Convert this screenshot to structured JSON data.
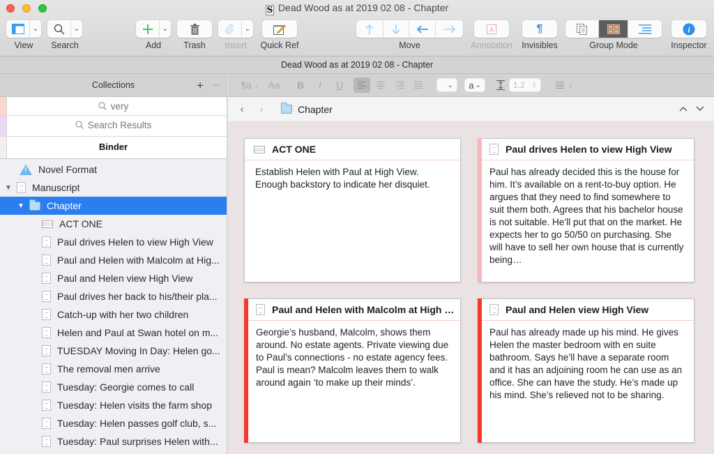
{
  "window": {
    "title": "Dead Wood as at 2019 02 08 - Chapter",
    "doc_icon_glyph": "S"
  },
  "toolbar": {
    "view": "View",
    "search": "Search",
    "add": "Add",
    "trash": "Trash",
    "insert": "Insert",
    "quick_ref": "Quick Ref",
    "move": "Move",
    "annotation": "Annotation",
    "invisibles": "Invisibles",
    "group_mode": "Group Mode",
    "inspector": "Inspector",
    "icons": {
      "view": "layout-icon",
      "search": "magnifier-icon",
      "add": "plus-icon",
      "trash": "trash-icon",
      "insert": "paperclip-icon",
      "quick_ref": "quick-ref-icon",
      "move": [
        "arrow-up-icon",
        "arrow-down-icon",
        "arrow-left-icon",
        "arrow-right-icon"
      ],
      "annotation": "annotation-icon",
      "invisibles": "pilcrow-icon",
      "group_mode": [
        "scrivenings-icon",
        "corkboard-icon",
        "outline-icon"
      ],
      "inspector": "info-icon"
    },
    "group_mode_active": "corkboard",
    "colors": {
      "add": "#3cc36a",
      "move": "#4aa7ee",
      "move_dim": "#a8d3f5",
      "annotation": "#f1a5a5",
      "invisibles": "#2b8ee8",
      "corkboard_active": "#f3b68a",
      "inspector": "#2b8ee8"
    }
  },
  "docbar": {
    "title": "Dead Wood as at 2019 02 08 - Chapter"
  },
  "sidebar": {
    "collections_label": "Collections",
    "add_collection": "+",
    "remove_collection": "−",
    "collection_tabs": [
      {
        "label": "very",
        "icon": "search-icon",
        "color": "#fcd6cb"
      },
      {
        "label": "Search Results",
        "icon": "search-icon",
        "color": "#ead8fb"
      },
      {
        "label": "Binder",
        "icon": "",
        "color": "#efeff4"
      }
    ],
    "binder": [
      {
        "label": "Novel Format",
        "icon": "info-warning-icon",
        "level": 0,
        "disclosure": ""
      },
      {
        "label": "Manuscript",
        "icon": "document-icon",
        "level": 0,
        "disclosure": "▼"
      },
      {
        "label": "Chapter",
        "icon": "folder-icon",
        "level": 1,
        "disclosure": "▼",
        "selected": true
      },
      {
        "label": "ACT ONE",
        "icon": "act-index-icon",
        "level": 2
      },
      {
        "label": "Paul drives Helen to view High View",
        "icon": "document-icon",
        "level": 2
      },
      {
        "label": "Paul and Helen with Malcolm at Hig...",
        "icon": "document-icon",
        "level": 2
      },
      {
        "label": "Paul and Helen view High View",
        "icon": "document-icon",
        "level": 2
      },
      {
        "label": "Paul drives her back to his/their pla...",
        "icon": "document-icon",
        "level": 2
      },
      {
        "label": "Catch-up with her two children",
        "icon": "document-icon",
        "level": 2
      },
      {
        "label": "Helen and Paul at Swan hotel on m...",
        "icon": "document-icon",
        "level": 2
      },
      {
        "label": "TUESDAY Moving In Day: Helen go...",
        "icon": "document-icon",
        "level": 2
      },
      {
        "label": "The removal men arrive",
        "icon": "document-icon",
        "level": 2
      },
      {
        "label": "Tuesday: Georgie comes to call",
        "icon": "document-icon",
        "level": 2
      },
      {
        "label": "Tuesday: Helen visits the farm shop",
        "icon": "document-icon",
        "level": 2
      },
      {
        "label": "Tuesday: Helen passes golf club, s...",
        "icon": "document-icon",
        "level": 2
      },
      {
        "label": "Tuesday: Paul surprises Helen with...",
        "icon": "document-icon",
        "level": 2
      }
    ],
    "selection_color": "#2a7ef0"
  },
  "formatbar": {
    "paragraph_style": "¶a",
    "font": "Aa",
    "bold": "B",
    "italic": "I",
    "underline": "U",
    "alignment_active": "left",
    "text_color_label": "a",
    "line_spacing": "1.2"
  },
  "breadcrumb": {
    "back": "‹",
    "forward": "›",
    "title": "Chapter",
    "up": "⌃",
    "down": "⌄"
  },
  "cards": [
    {
      "title": "ACT ONE",
      "icon": "act-index-icon",
      "label_color": "",
      "synopsis": "Establish Helen with Paul at High View. Enough backstory to indicate her disquiet."
    },
    {
      "title": "Paul drives Helen to view High View",
      "icon": "document-icon",
      "label_color": "#f5b8bc",
      "synopsis": "Paul has already decided this is the house for him. It’s available on a rent-to-buy option. He argues that they need to find somewhere to suit them both. Agrees that his bachelor house is not suitable. He’ll put that on the market. He expects her to go 50/50 on purchasing. She will have to sell her own house that is currently being…"
    },
    {
      "title": "Paul and Helen with Malcolm at High Vi...",
      "icon": "document-icon",
      "label_color": "#f2392b",
      "synopsis": "Georgie’s husband, Malcolm, shows them around. No estate agents. Private viewing due to Paul’s connections - no estate agency fees. Paul is mean? Malcolm leaves them to walk around again ‘to make up their minds’."
    },
    {
      "title": "Paul and Helen view High View",
      "icon": "document-icon",
      "label_color": "#f2392b",
      "synopsis": "Paul has already made up his mind. He gives Helen the master bedroom with en suite bathroom. Says he’ll have a separate room and it has an adjoining room he can use as an office. She can have the study. He’s made up his mind. She’s relieved not to be sharing."
    }
  ]
}
